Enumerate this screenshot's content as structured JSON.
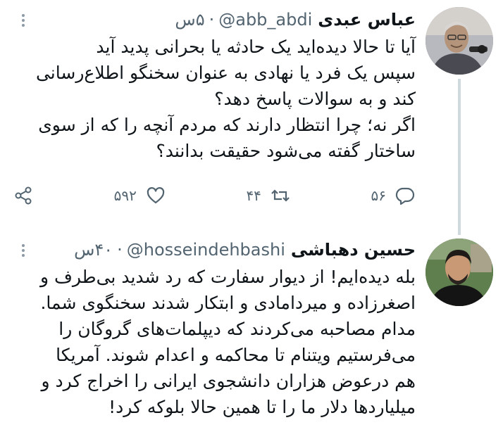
{
  "tweets": [
    {
      "name": "عباس عبدی",
      "handle": "@abb_abdi",
      "time": "۵س",
      "separator": "·",
      "avatar_icon": "avatar-photo",
      "lines": [
        "آیا تا حالا دیده‌اید یک حادثه یا بحرانی پدید آید",
        "سپس یک فرد یا نهادی به عنوان سخنگو اطلاع‌رسانی",
        "کند و به سوالات پاسخ دهد؟",
        "اگر نه؛ چرا انتظار دارند که مردم آنچه را که از سوی",
        "ساختار گفته می‌شود حقیقت بدانند؟"
      ],
      "replies": "۵۶",
      "retweets": "۴۴",
      "likes": "۵۹۲"
    },
    {
      "name": "حسین دهباشی",
      "handle": "@hosseindehbashi",
      "time": "۴۰س",
      "separator": "·",
      "avatar_icon": "avatar-photo",
      "lines": [
        "بله دیده‌ایم! از دیوار سفارت که رد شدید بی‌طرف و",
        "اصغرزاده و میردامادی و ابتکار شدند سخنگوی شما.",
        "مدام مصاحبه می‌کردند که دیپلمات‌های گروگان را",
        "می‌فرستیم ویتنام تا محاکمه و اعدام شوند. آمریکا",
        "هم درعوض هزاران دانشجوی ایرانی را اخراج کرد و",
        "میلیاردها دلار ما را تا همین حالا بلوکه کرد!"
      ]
    }
  ],
  "colors": {
    "text": "#0f1419",
    "secondary": "#536471",
    "thread_line": "#cfd9de"
  }
}
